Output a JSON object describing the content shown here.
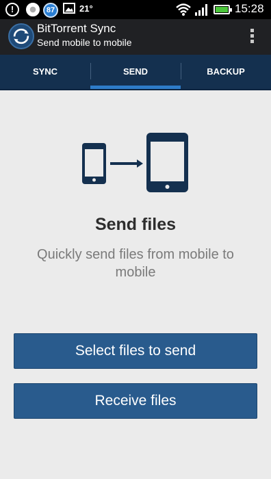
{
  "status_bar": {
    "badge_count": "87",
    "temperature": "21°",
    "clock": "15:28",
    "icons": [
      "alert-icon",
      "chrome-icon",
      "badge-icon",
      "picture-icon",
      "wifi-icon",
      "signal-icon",
      "battery-icon"
    ]
  },
  "action_bar": {
    "title": "BitTorrent Sync",
    "subtitle": "Send mobile to mobile"
  },
  "tabs": [
    {
      "label": "SYNC"
    },
    {
      "label": "SEND",
      "active": true
    },
    {
      "label": "BACKUP"
    }
  ],
  "main": {
    "heading": "Send files",
    "description": "Quickly send files from mobile to mobile",
    "select_button": "Select files to send",
    "receive_button": "Receive files"
  },
  "colors": {
    "accent": "#2e7cc9",
    "tab_bar": "#14304f",
    "button": "#295b8d"
  }
}
